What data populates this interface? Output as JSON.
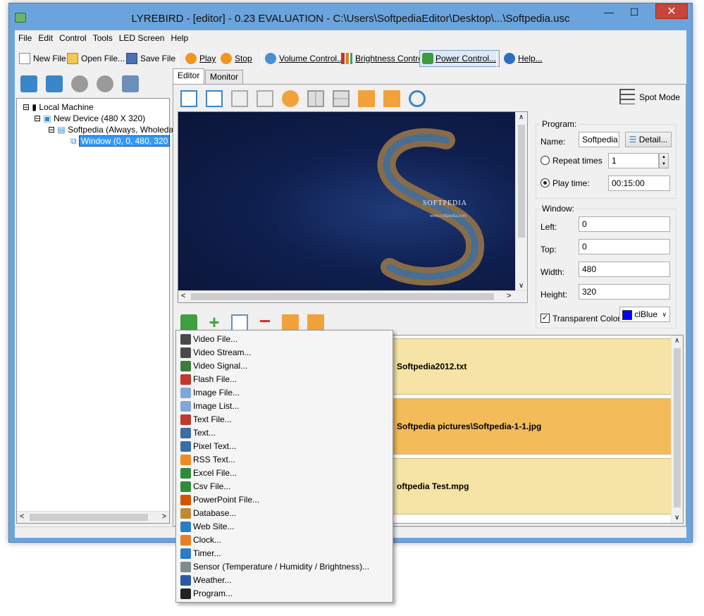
{
  "window": {
    "title": "LYREBIRD - [editor] - 0.23 EVALUATION - C:\\Users\\SoftpediaEditor\\Desktop\\...\\Softpedia.usc",
    "close_glyph": "✕",
    "min_glyph": "—",
    "max_glyph": "☐"
  },
  "menubar": [
    "File",
    "Edit",
    "Control",
    "Tools",
    "LED Screen",
    "Help"
  ],
  "toolbar": {
    "new_file": "New File",
    "open_file": "Open File...",
    "save_file": "Save File",
    "play": "Play",
    "stop": "Stop",
    "volume": "Volume Control...",
    "brightness": "Brightness Control",
    "power": "Power Control...",
    "help": "Help..."
  },
  "tree": {
    "local_machine": "Local Machine",
    "device": "New Device (480 X 320)",
    "program": "Softpedia (Always, Wholeda",
    "window": "Window (0, 0, 480, 320"
  },
  "tabs": {
    "editor": "Editor",
    "monitor": "Monitor"
  },
  "preview": {
    "logo_text": "SOFTPEDIA",
    "url_text": "www.softpedia.com"
  },
  "program": {
    "group_title": "Program:",
    "name_label": "Name:",
    "name_value": "Softpedia",
    "detail_button": "Detail...",
    "repeat_label": "Repeat times",
    "repeat_value": "1",
    "play_time_label": "Play time:",
    "play_time_value": "00:15:00",
    "selected_mode": "play_time"
  },
  "window_props": {
    "group_title": "Window:",
    "left_label": "Left:",
    "left_value": "0",
    "top_label": "Top:",
    "top_value": "0",
    "width_label": "Width:",
    "width_value": "480",
    "height_label": "Height:",
    "height_value": "320",
    "transparent_label": "Transparent Color:",
    "transparent_checked": true,
    "color_value": "clBlue",
    "color_hex": "#0000ff"
  },
  "spot_mode": "Spot Mode",
  "items": [
    {
      "text": "Softpedia2012.txt",
      "color": "#f5e4a5"
    },
    {
      "text": "Softpedia pictures\\Softpedia-1-1.jpg",
      "color": "#f3bb5a"
    },
    {
      "text": "oftpedia Test.mpg",
      "color": "#f5e4a5"
    }
  ],
  "menu": [
    {
      "label": "Video File...",
      "icon": "video-file-icon",
      "color": "#4a4a4a"
    },
    {
      "label": "Video Stream...",
      "icon": "video-stream-icon",
      "color": "#4a4a4a"
    },
    {
      "label": "Video Signal...",
      "icon": "video-signal-icon",
      "color": "#3d7a3d"
    },
    {
      "label": "Flash File...",
      "icon": "flash-file-icon",
      "color": "#c0392b"
    },
    {
      "label": "Image File...",
      "icon": "image-file-icon",
      "color": "#7fa8d6"
    },
    {
      "label": "Image List...",
      "icon": "image-list-icon",
      "color": "#7fa8d6"
    },
    {
      "label": "Text File...",
      "icon": "text-file-icon",
      "color": "#c0392b"
    },
    {
      "label": "Text...",
      "icon": "text-icon",
      "color": "#3a6ea5"
    },
    {
      "label": "Pixel Text...",
      "icon": "pixel-text-icon",
      "color": "#3a6ea5"
    },
    {
      "label": "RSS Text...",
      "icon": "rss-icon",
      "color": "#f08a24"
    },
    {
      "label": "Excel File...",
      "icon": "excel-file-icon",
      "color": "#2e8b3a"
    },
    {
      "label": "Csv File...",
      "icon": "csv-file-icon",
      "color": "#2e8b3a"
    },
    {
      "label": "PowerPoint File...",
      "icon": "powerpoint-file-icon",
      "color": "#d35400"
    },
    {
      "label": "Database...",
      "icon": "database-icon",
      "color": "#c08a2e"
    },
    {
      "label": "Web Site...",
      "icon": "web-site-icon",
      "color": "#2a7dc4"
    },
    {
      "label": "Clock...",
      "icon": "clock-icon",
      "color": "#e67e22"
    },
    {
      "label": "Timer...",
      "icon": "timer-icon",
      "color": "#2a7dc4"
    },
    {
      "label": "Sensor (Temperature / Humidity / Brightness)...",
      "icon": "sensor-icon",
      "color": "#7f8c8d"
    },
    {
      "label": "Weather...",
      "icon": "weather-icon",
      "color": "#2a5aa5"
    },
    {
      "label": "Program...",
      "icon": "program-icon",
      "color": "#222222"
    }
  ]
}
